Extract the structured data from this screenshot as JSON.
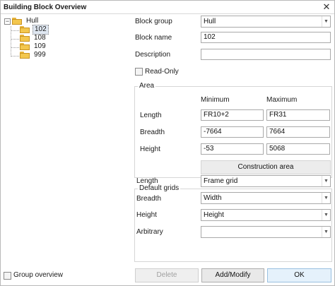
{
  "window": {
    "title": "Building Block Overview",
    "close_glyph": "✕"
  },
  "tree": {
    "root": {
      "label": "Hull",
      "expander": "−"
    },
    "children": [
      {
        "label": "102",
        "selected": true
      },
      {
        "label": "108"
      },
      {
        "label": "109"
      },
      {
        "label": "999"
      }
    ]
  },
  "form": {
    "block_group": {
      "label": "Block group",
      "value": "Hull"
    },
    "block_name": {
      "label": "Block name",
      "value": "102"
    },
    "description": {
      "label": "Description",
      "value": ""
    },
    "read_only": {
      "label": "Read-Only",
      "checked": false
    }
  },
  "area": {
    "title": "Area",
    "col_min": "Minimum",
    "col_max": "Maximum",
    "rows": [
      {
        "label": "Length",
        "min": "FR10+2",
        "max": "FR31"
      },
      {
        "label": "Breadth",
        "min": "-7664",
        "max": "7664"
      },
      {
        "label": "Height",
        "min": "-53",
        "max": "5068"
      }
    ],
    "button": "Construction area"
  },
  "default_grids": {
    "title": "Default grids",
    "rows": [
      {
        "label": "Length",
        "value": "Frame grid"
      },
      {
        "label": "Breadth",
        "value": "Width"
      },
      {
        "label": "Height",
        "value": "Height"
      },
      {
        "label": "Arbitrary",
        "value": ""
      }
    ]
  },
  "group_overview": {
    "label": "Group overview",
    "checked": false
  },
  "buttons": {
    "delete": "Delete",
    "add_modify": "Add/Modify",
    "ok": "OK"
  },
  "colors": {
    "folder": "#f3c74e",
    "selection": "#dfe7f1",
    "group_border": "#d6d6d6"
  }
}
